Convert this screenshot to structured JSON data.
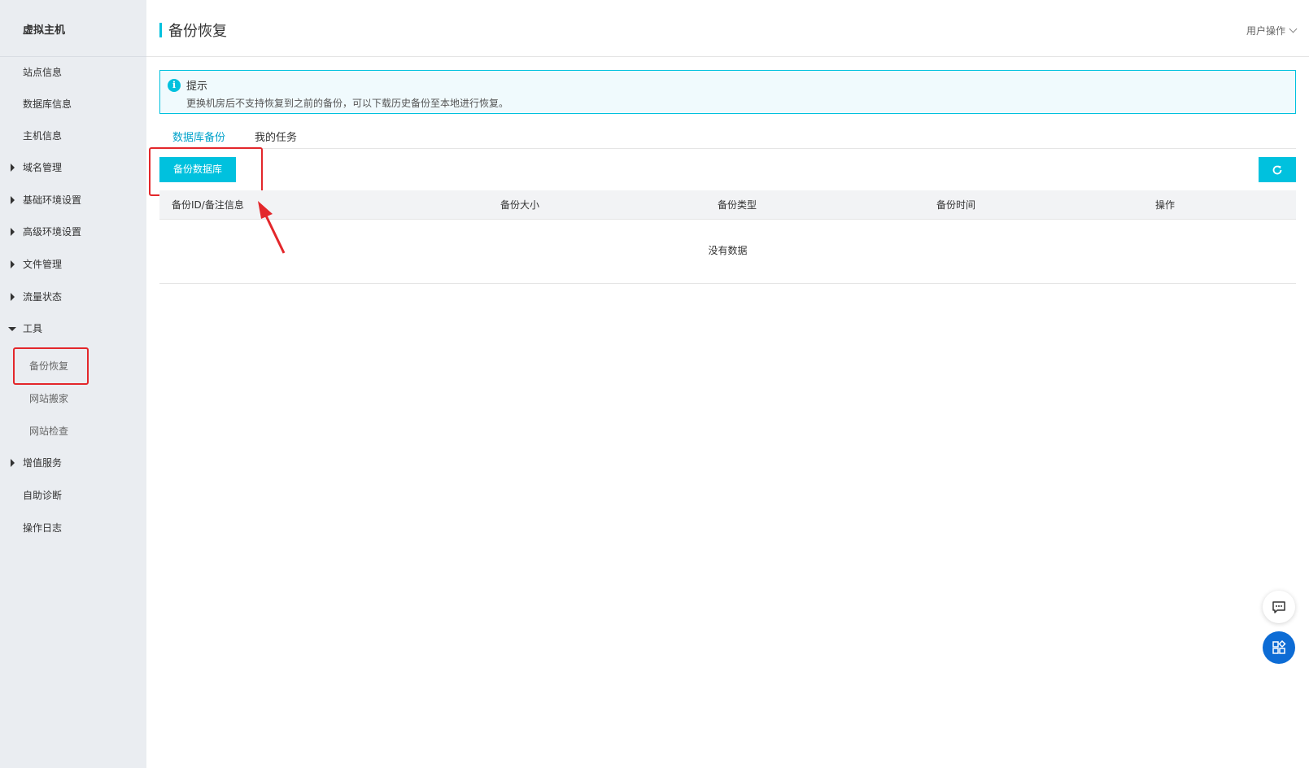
{
  "sidebar": {
    "title": "虚拟主机",
    "items": [
      {
        "label": "站点信息"
      },
      {
        "label": "数据库信息"
      },
      {
        "label": "主机信息"
      },
      {
        "label": "域名管理"
      },
      {
        "label": "基础环境设置"
      },
      {
        "label": "高级环境设置"
      },
      {
        "label": "文件管理"
      },
      {
        "label": "流量状态"
      },
      {
        "label": "工具"
      },
      {
        "label": "备份恢复"
      },
      {
        "label": "网站搬家"
      },
      {
        "label": "网站检查"
      },
      {
        "label": "增值服务"
      },
      {
        "label": "自助诊断"
      },
      {
        "label": "操作日志"
      }
    ]
  },
  "header": {
    "title": "备份恢复",
    "user_ops": "用户操作"
  },
  "notice": {
    "title": "提示",
    "text": "更换机房后不支持恢复到之前的备份，可以下载历史备份至本地进行恢复。"
  },
  "tabs": [
    {
      "label": "数据库备份"
    },
    {
      "label": "我的任务"
    }
  ],
  "toolbar": {
    "backup_label": "备份数据库"
  },
  "table": {
    "columns": [
      "备份ID/备注信息",
      "备份大小",
      "备份类型",
      "备份时间",
      "操作"
    ],
    "empty_text": "没有数据"
  },
  "colors": {
    "accent": "#00c1de",
    "highlight": "#e3272b",
    "fab_blue": "#0d6cd5"
  }
}
